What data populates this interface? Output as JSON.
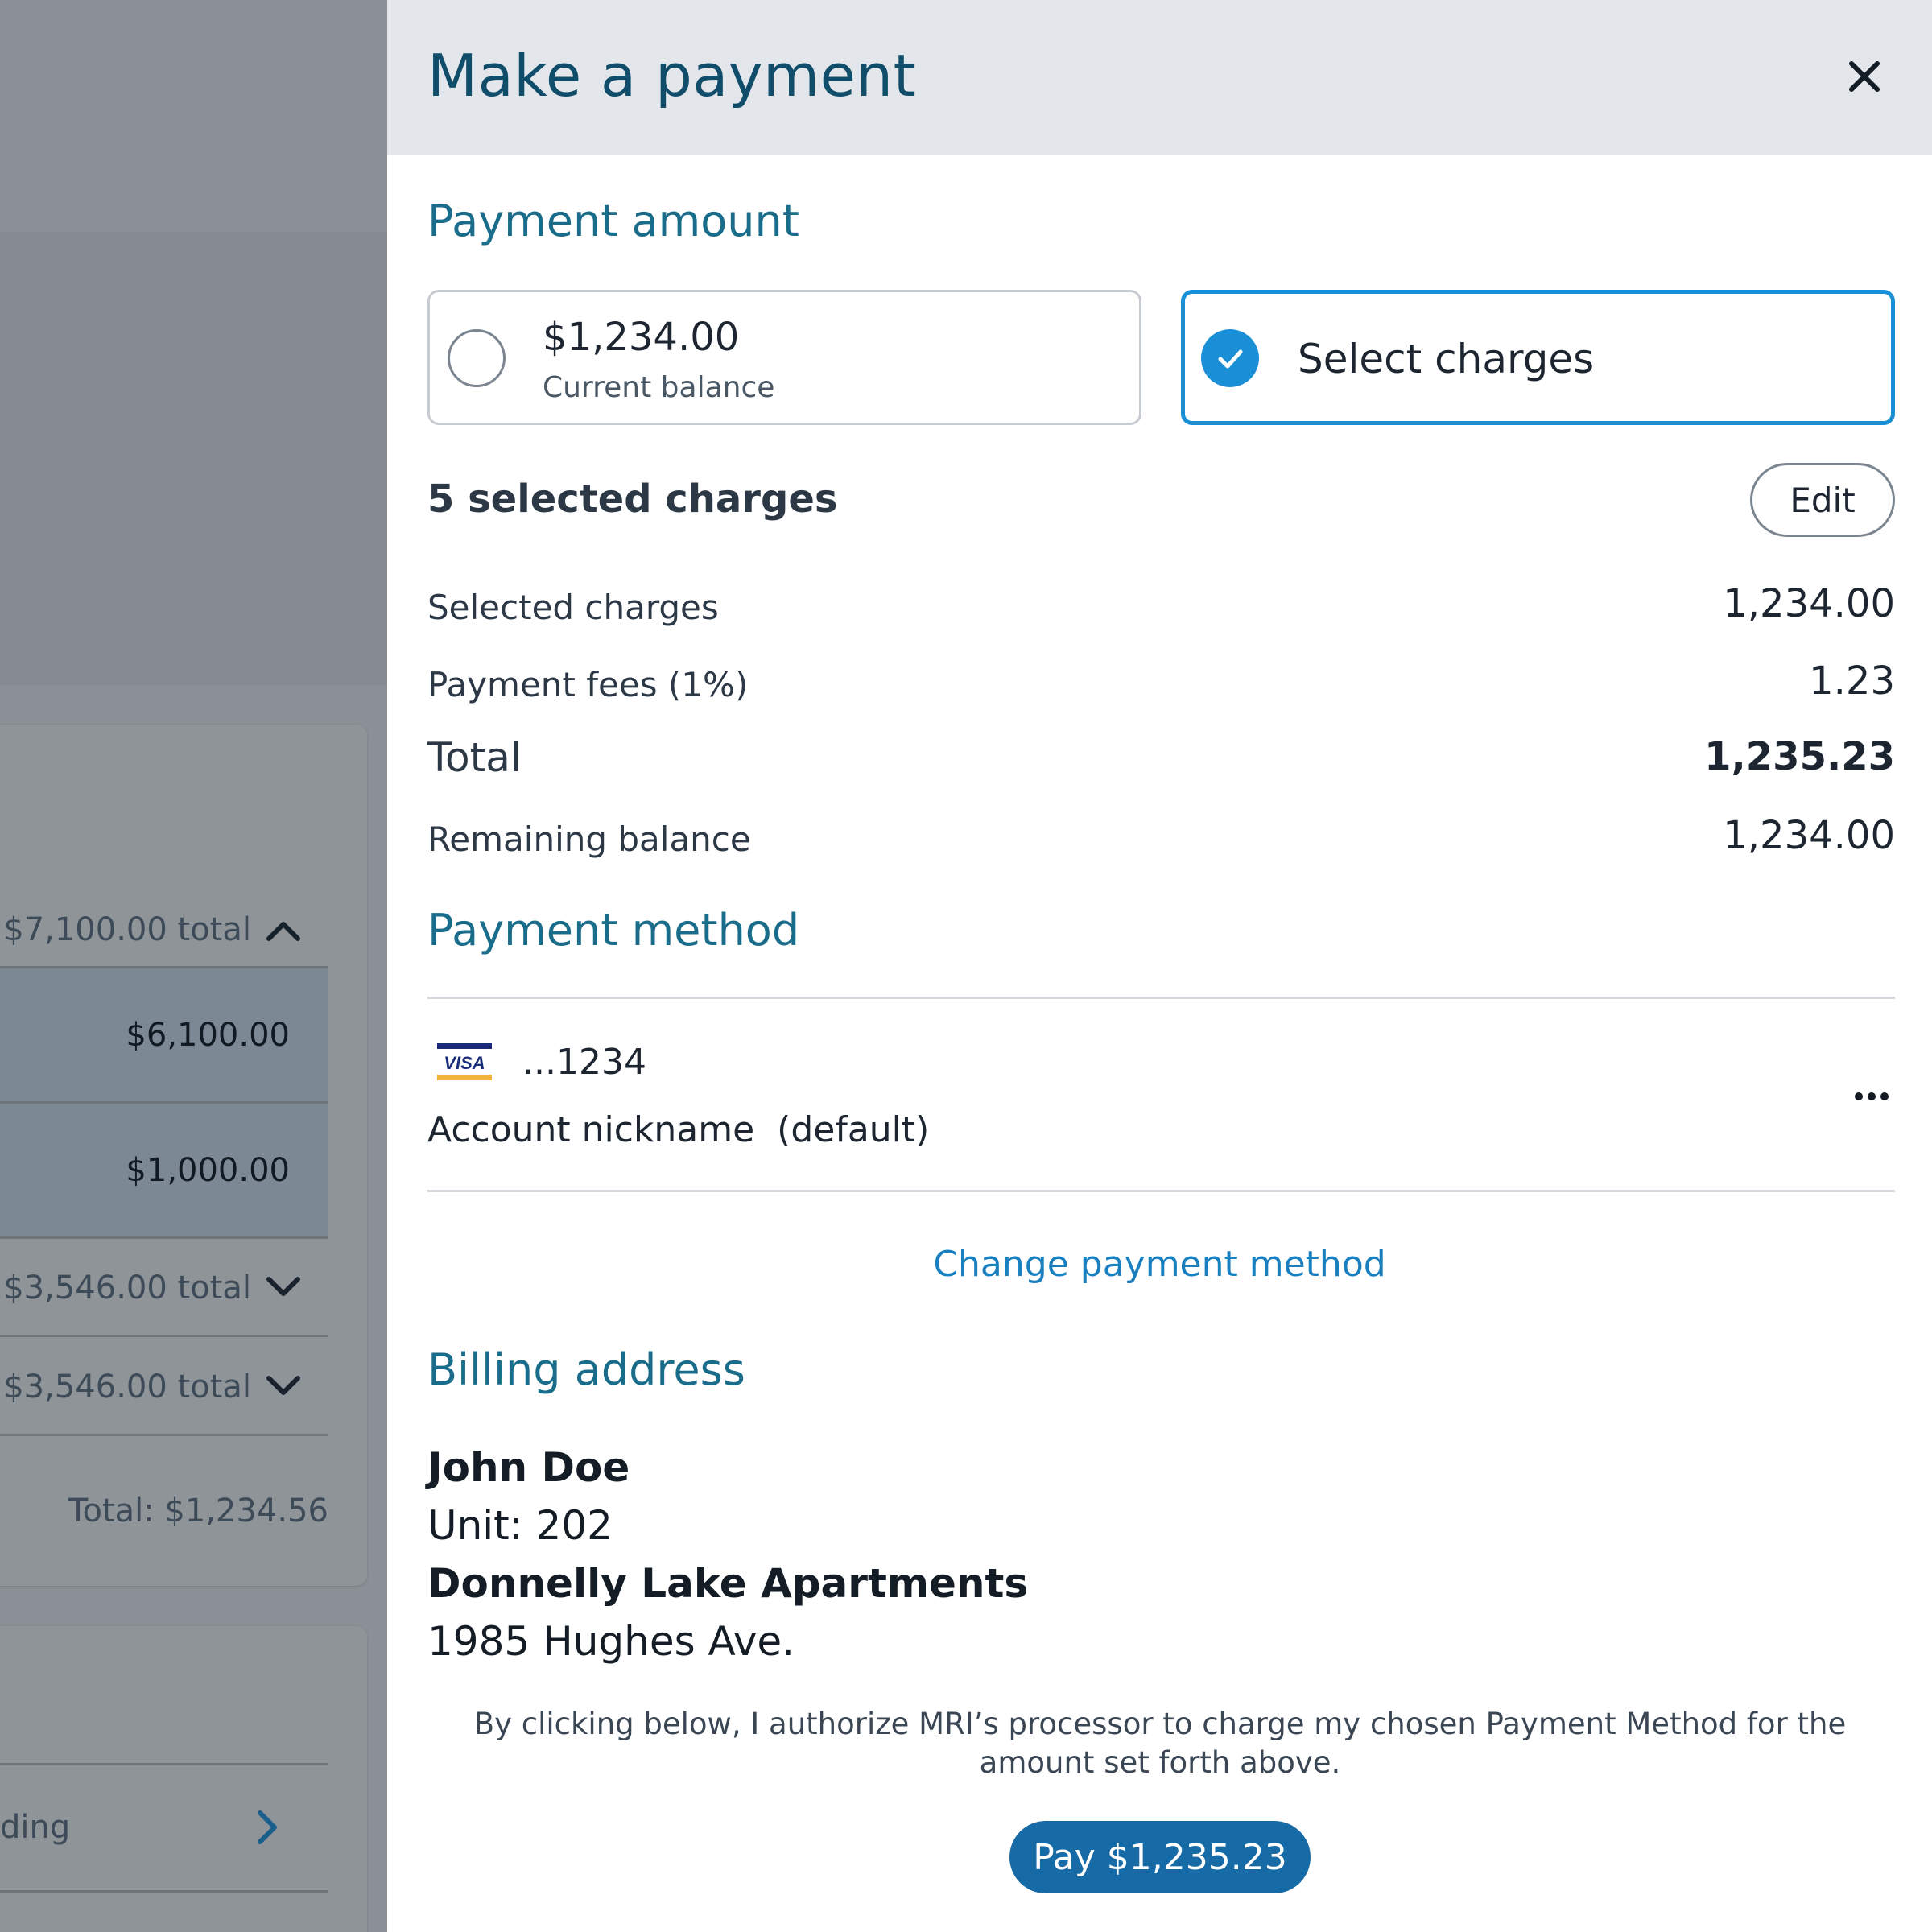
{
  "background": {
    "groups": [
      {
        "total": "$7,100.00 total",
        "chevron": "chevron-up-icon"
      },
      {
        "total": "$3,546.00 total",
        "chevron": "chevron-down-icon"
      },
      {
        "total": "$3,546.00 total",
        "chevron": "chevron-down-icon"
      }
    ],
    "selected_rows": [
      "$6,100.00",
      "$1,000.00"
    ],
    "card_total": "Total: $1,234.56",
    "nav_item_partial": "ding"
  },
  "modal": {
    "title": "Make a payment",
    "close_icon": "close-icon",
    "payment_amount": {
      "heading": "Payment amount",
      "balance_option": {
        "amount": "$1,234.00",
        "caption": "Current balance",
        "selected": false
      },
      "select_option": {
        "label": "Select charges",
        "selected": true
      }
    },
    "charges": {
      "count_label": "5 selected charges",
      "edit_label": "Edit",
      "rows": [
        {
          "label": "Selected charges",
          "value": "1,234.00"
        },
        {
          "label": "Payment fees (1%)",
          "value": "1.23"
        },
        {
          "label": "Total",
          "value": "1,235.23"
        },
        {
          "label": "Remaining balance",
          "value": "1,234.00"
        }
      ]
    },
    "payment_method": {
      "heading": "Payment method",
      "card_brand": "VISA",
      "card_last4": "...1234",
      "nickname": "Account nickname  (default)",
      "more_icon": "more-horizontal-icon",
      "change_link": "Change payment method"
    },
    "billing": {
      "heading": "Billing address",
      "name": "John Doe",
      "unit": "Unit: 202",
      "property": "Donnelly Lake Apartments",
      "street": "1985 Hughes Ave."
    },
    "authorization": "By clicking below, I authorize MRI’s processor to charge my chosen Payment Method for the amount set forth above.",
    "pay_button": "Pay $1,235.23",
    "colors": {
      "accent": "#1a8fd6",
      "pay_button": "#166aa6",
      "heading": "#1a6d8a",
      "header_bg": "#e3e6ea"
    }
  }
}
